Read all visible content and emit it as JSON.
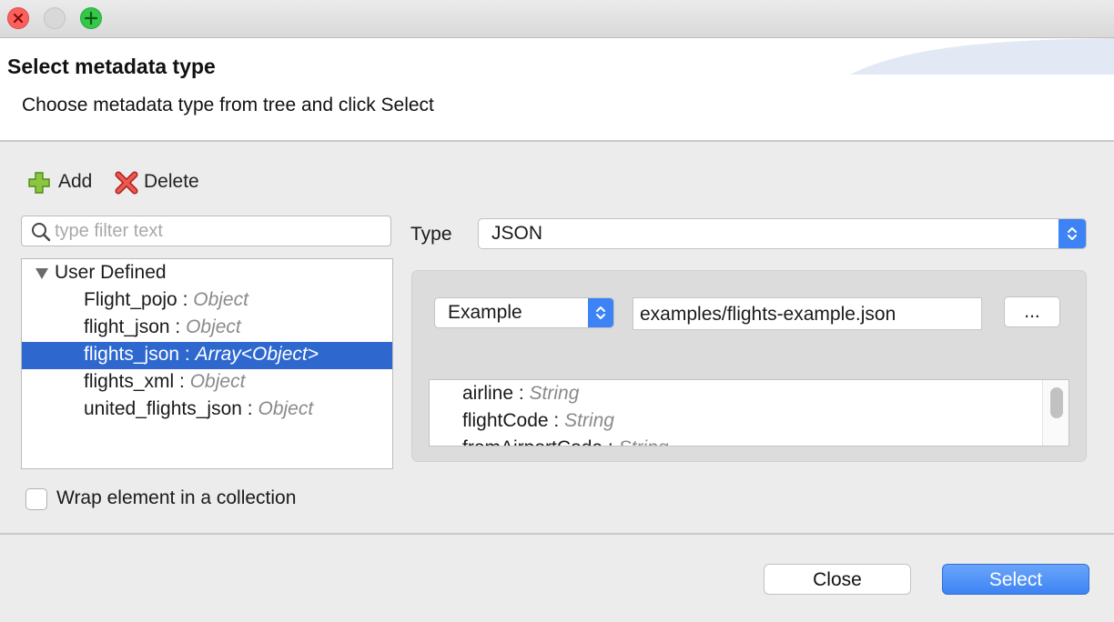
{
  "dialog": {
    "title": "Select metadata type",
    "subtitle": "Choose metadata type from tree and click Select"
  },
  "toolbar": {
    "add_label": "Add",
    "delete_label": "Delete"
  },
  "filter": {
    "placeholder": "type filter text",
    "value": ""
  },
  "tree": {
    "root_label": "User Defined",
    "items": [
      {
        "name": "Flight_pojo",
        "type": "Object",
        "selected": false
      },
      {
        "name": "flight_json",
        "type": "Object",
        "selected": false
      },
      {
        "name": "flights_json",
        "type": "Array<Object>",
        "selected": true
      },
      {
        "name": "flights_xml",
        "type": "Object",
        "selected": false
      },
      {
        "name": "united_flights_json",
        "type": "Object",
        "selected": false
      }
    ],
    "separator": " : "
  },
  "wrap_checkbox": {
    "label": "Wrap element in a collection",
    "checked": false
  },
  "type_select": {
    "label": "Type",
    "value": "JSON"
  },
  "example": {
    "mode": "Example",
    "path": "examples/flights-example.json",
    "browse_label": "..."
  },
  "fields": [
    {
      "name": "airline",
      "type": "String"
    },
    {
      "name": "flightCode",
      "type": "String"
    },
    {
      "name": "fromAirportCode",
      "type": "String"
    }
  ],
  "buttons": {
    "close_label": "Close",
    "select_label": "Select"
  },
  "colors": {
    "selection": "#2e68cf",
    "accent": "#3d83f4",
    "close_light": "#fc605c",
    "zoom_light": "#34c84a"
  },
  "icons": {
    "add": "plus-icon",
    "delete": "x-icon",
    "filter": "search-icon"
  }
}
